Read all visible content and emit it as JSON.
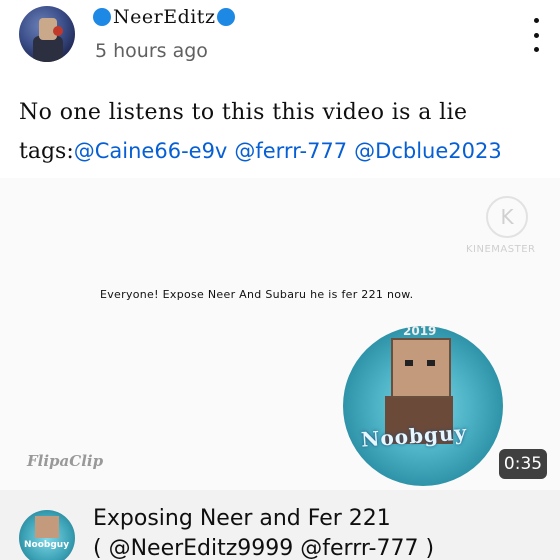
{
  "post": {
    "channel_name": "NeerEditz",
    "time_ago": "5 hours ago",
    "text": "No one listens to this this video is a lie",
    "tags_prefix": "tags:",
    "tags": [
      "@Caine66-e9v",
      "@ferrr-777",
      "@Dcblue2023"
    ]
  },
  "video": {
    "watermark": "KINEMASTER",
    "watermark_logo": "K",
    "caption": "Everyone! Expose Neer And Subaru he is fer 221 now.",
    "flipaclip": "FlipaClip",
    "thumb_label": "Noobguy",
    "thumb_year": "2019",
    "duration": "0:35"
  },
  "footer": {
    "title_line1": "Exposing Neer and Fer 221",
    "title_line2": "( @NeerEditz9999  @ferrr-777 )",
    "avatar_label": "Noobguy"
  },
  "colors": {
    "link": "#065fd4",
    "verified_dot": "#1e88e5",
    "footer_bg": "#f2f2f2"
  }
}
